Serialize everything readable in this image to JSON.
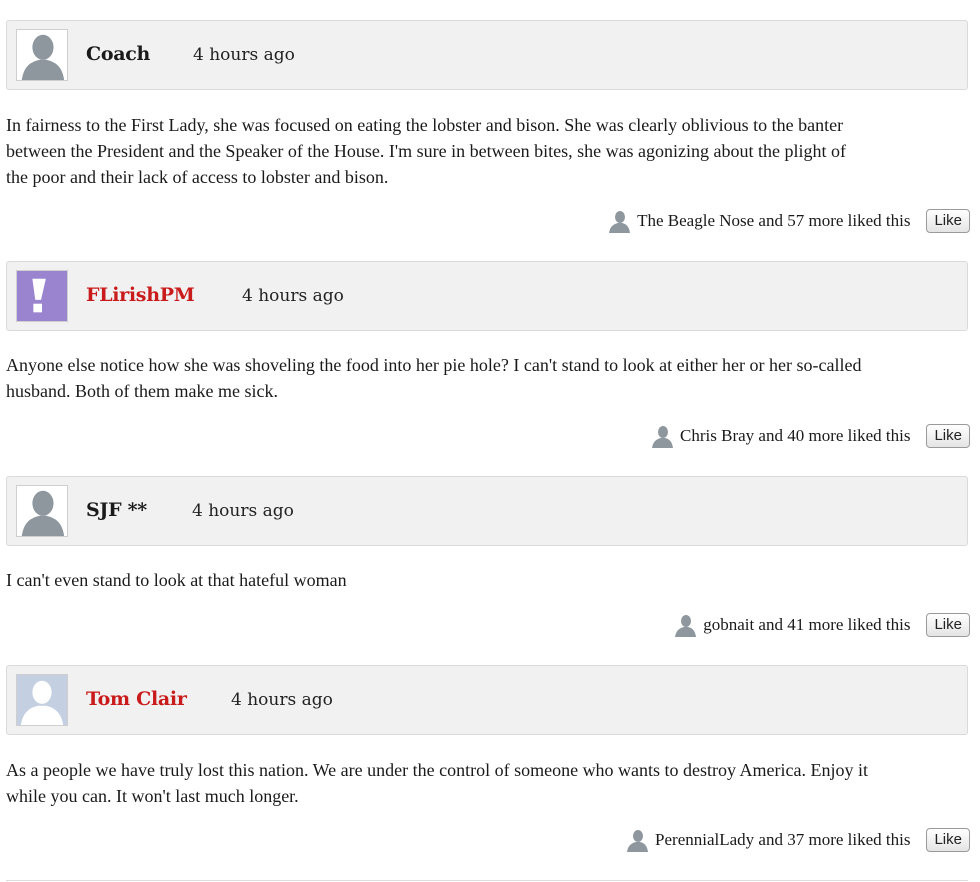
{
  "comments": [
    {
      "author": "Coach",
      "author_color": "#1a1a1a",
      "avatar": "default-silhouette-icon",
      "time": "4 hours ago",
      "body_lines": [
        "In fairness to the First Lady, she was focused on eating the lobster and bison.  She was clearly oblivious to the banter",
        "between the President and the Speaker of the House.  I'm sure in between bites, she was agonizing about the plight of",
        "the poor and their lack of access to lobster and bison."
      ],
      "likes_text": "The Beagle Nose and 57 more liked this",
      "like_label": "Like"
    },
    {
      "author": "FLirishPM",
      "author_color": "#c91b1b",
      "avatar": "exclamation-avatar-icon",
      "time": "4 hours ago",
      "body_lines": [
        "Anyone else notice how she was shoveling the food into her pie hole? I can't stand to look at either her or her so-called",
        "husband. Both of them make me sick."
      ],
      "likes_text": "Chris Bray and 40 more liked this",
      "like_label": "Like"
    },
    {
      "author": "SJF **",
      "author_color": "#1a1a1a",
      "avatar": "default-silhouette-icon",
      "time": "4 hours ago",
      "body_lines": [
        "I can't even stand to look at that hateful woman"
      ],
      "likes_text": "gobnait and 41 more liked this",
      "like_label": "Like"
    },
    {
      "author": "Tom Clair",
      "author_color": "#c91b1b",
      "avatar": "blue-silhouette-icon",
      "time": "4 hours ago",
      "body_lines": [
        "As a people we have truly lost this nation. We are under the control of someone who wants to destroy America. Enjoy it",
        "while you can. It won't last much longer."
      ],
      "likes_text": "PerennialLady and 37 more liked this",
      "like_label": "Like"
    }
  ]
}
